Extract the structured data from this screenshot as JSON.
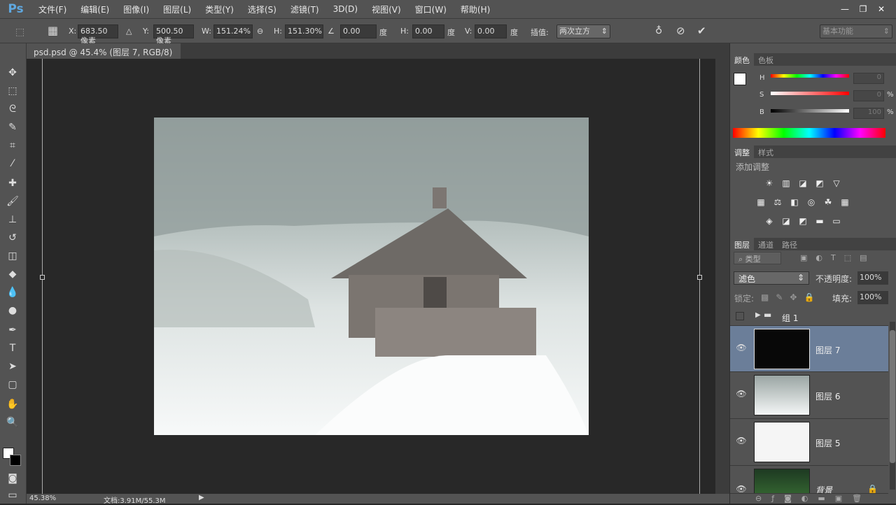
{
  "app": {
    "logo": "Ps"
  },
  "menu": [
    "文件(F)",
    "编辑(E)",
    "图像(I)",
    "图层(L)",
    "类型(Y)",
    "选择(S)",
    "滤镜(T)",
    "3D(D)",
    "视图(V)",
    "窗口(W)",
    "帮助(H)"
  ],
  "window_controls": [
    "—",
    "❐",
    "✕"
  ],
  "options": {
    "x_label": "X:",
    "x": "683.50 像素",
    "y_label": "Y:",
    "y": "500.50 像素",
    "w_label": "W:",
    "w": "151.24%",
    "h_label": "H:",
    "h": "151.30%",
    "angle": "0.00",
    "deg": "度",
    "hskew_label": "H:",
    "hskew": "0.00",
    "vskew_label": "V:",
    "vskew": "0.00",
    "interp_label": "插值:",
    "interp": "两次立方",
    "workspace": "基本功能"
  },
  "document": {
    "tab": "psd.psd @ 45.4% (图层 7, RGB/8) *",
    "close": "×"
  },
  "status": {
    "zoom": "45.38%",
    "doc": "文档:3.91M/55.3M"
  },
  "color_panel": {
    "tabs": [
      "颜色",
      "色板"
    ],
    "h_label": "H",
    "s_label": "S",
    "b_label": "B",
    "h": "0",
    "s": "0",
    "b": "100",
    "pct": "%"
  },
  "adjust_panel": {
    "tabs": [
      "调整",
      "样式"
    ],
    "title": "添加调整"
  },
  "layers_panel": {
    "tabs": [
      "图层",
      "通道",
      "路径"
    ],
    "filter": "类型",
    "blend": "滤色",
    "opacity_label": "不透明度:",
    "opacity": "100%",
    "lock_label": "锁定:",
    "fill_label": "填充:",
    "fill": "100%",
    "layers": [
      {
        "name": "组 1",
        "type": "group",
        "visible": false
      },
      {
        "name": "图层 7",
        "selected": true,
        "visible": true
      },
      {
        "name": "图层 6",
        "visible": true
      },
      {
        "name": "图层 5",
        "visible": true
      },
      {
        "name": "背景",
        "visible": true,
        "locked": true
      }
    ]
  },
  "colors": {
    "accent": "#6b7e99",
    "chrome": "#535353",
    "canvas_bg": "#282828"
  }
}
